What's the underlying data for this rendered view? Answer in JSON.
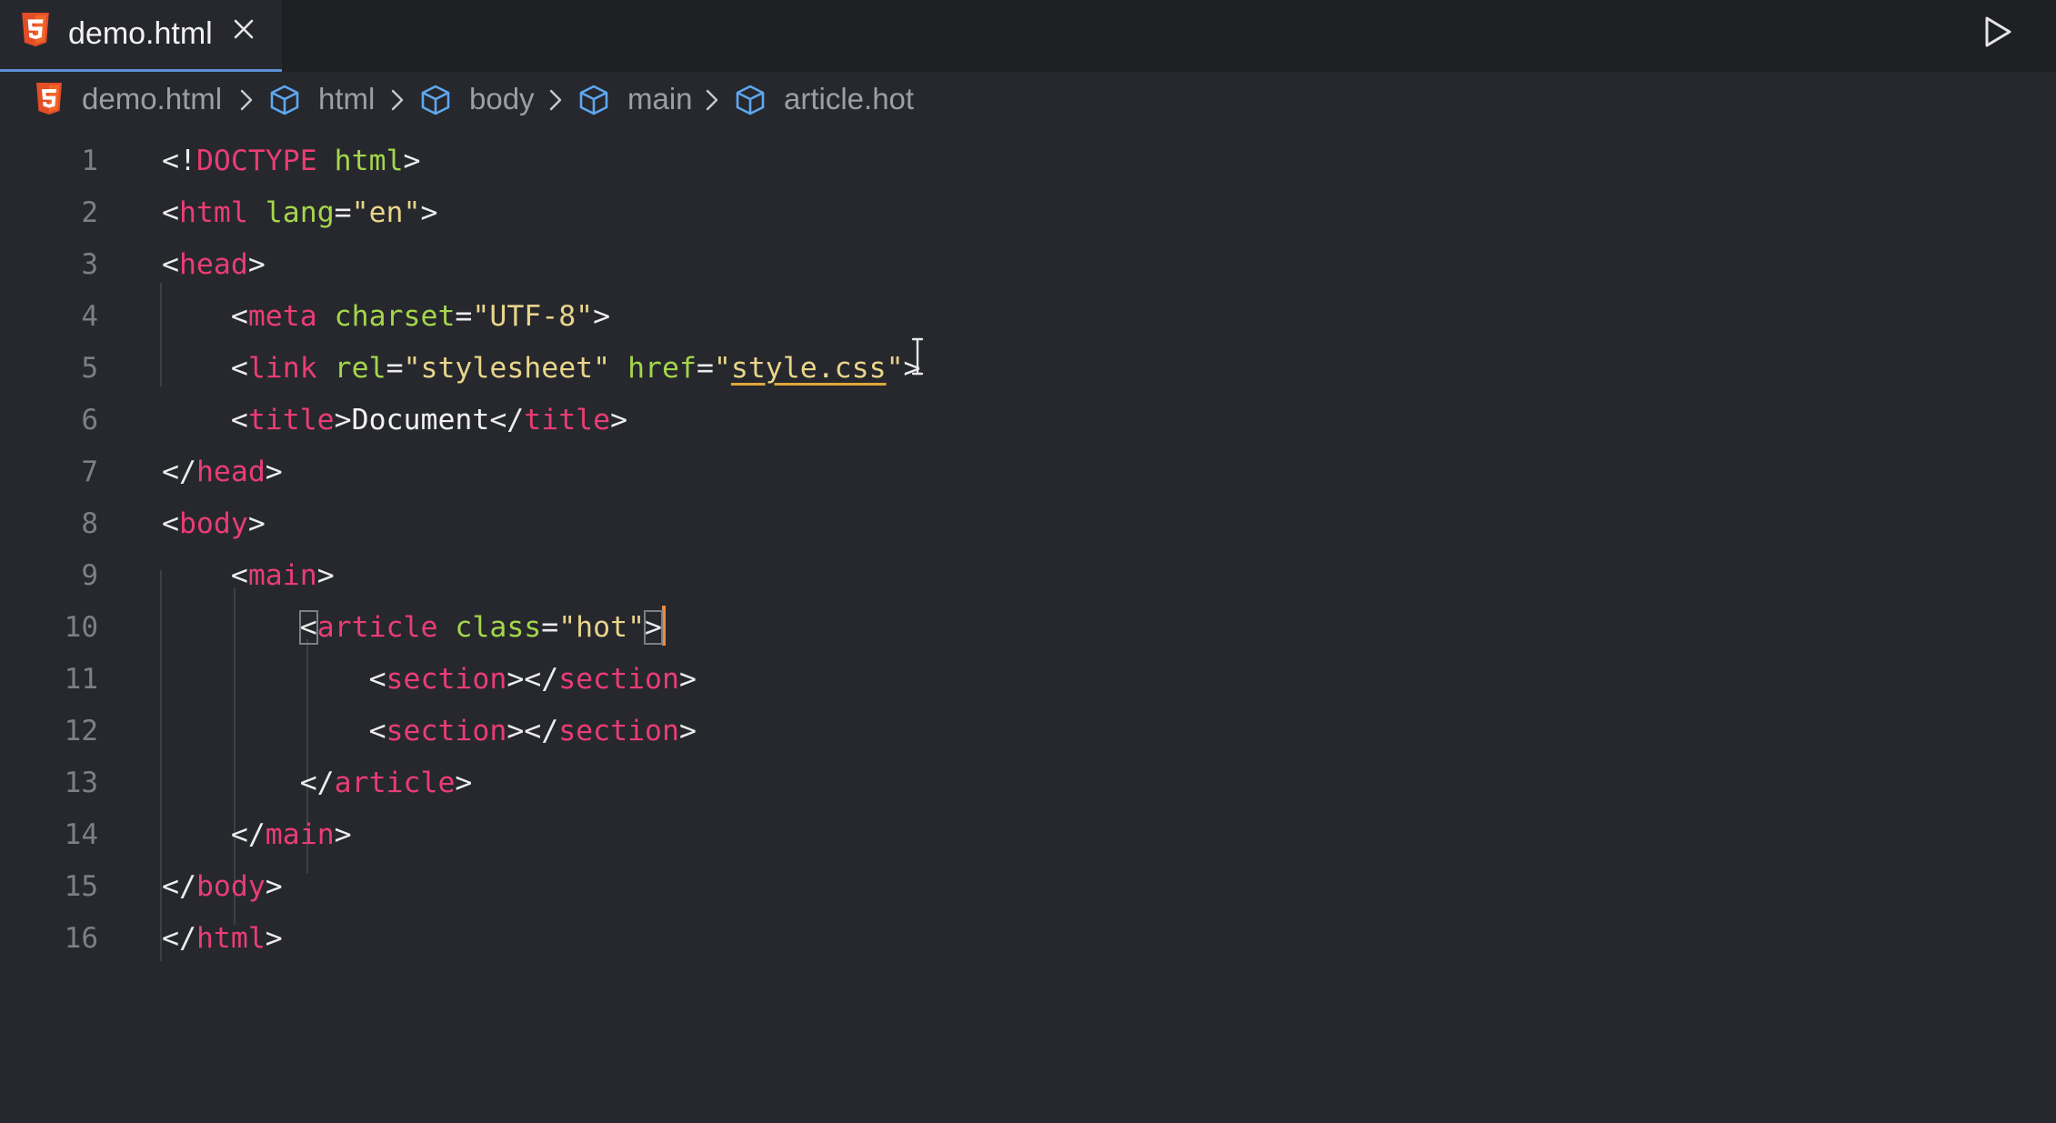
{
  "tab": {
    "title": "demo.html",
    "icon": "html5-icon",
    "close_icon": "close-icon"
  },
  "toolbar": {
    "run_icon": "play-icon"
  },
  "breadcrumb": {
    "file": "demo.html",
    "path": [
      "html",
      "body",
      "main",
      "article.hot"
    ]
  },
  "colors": {
    "background": "#26282d",
    "tabbar": "#1e2023",
    "tag": "#ea3d73",
    "attribute": "#a5d64b",
    "string": "#e9d58a",
    "line_number": "#7b8088",
    "caret": "#ef8a3a",
    "html_icon": "#e44d26",
    "cube_icon": "#5fa8f0"
  },
  "editor": {
    "line_numbers": [
      "1",
      "2",
      "3",
      "4",
      "5",
      "6",
      "7",
      "8",
      "9",
      "10",
      "11",
      "12",
      "13",
      "14",
      "15",
      "16"
    ],
    "lines": [
      [
        [
          "punc",
          "<!"
        ],
        [
          "tag",
          "DOCTYPE"
        ],
        [
          "punc",
          " "
        ],
        [
          "attr",
          "html"
        ],
        [
          "punc",
          ">"
        ]
      ],
      [
        [
          "punc",
          "<"
        ],
        [
          "tag",
          "html"
        ],
        [
          "punc",
          " "
        ],
        [
          "attr",
          "lang"
        ],
        [
          "punc",
          "="
        ],
        [
          "str",
          "\"en\""
        ],
        [
          "punc",
          ">"
        ]
      ],
      [
        [
          "punc",
          "<"
        ],
        [
          "tag",
          "head"
        ],
        [
          "punc",
          ">"
        ]
      ],
      [
        [
          "punc",
          "    <"
        ],
        [
          "tag",
          "meta"
        ],
        [
          "punc",
          " "
        ],
        [
          "attr",
          "charset"
        ],
        [
          "punc",
          "="
        ],
        [
          "str",
          "\"UTF-8\""
        ],
        [
          "punc",
          ">"
        ]
      ],
      [
        [
          "punc",
          "    <"
        ],
        [
          "tag",
          "link"
        ],
        [
          "punc",
          " "
        ],
        [
          "attr",
          "rel"
        ],
        [
          "punc",
          "="
        ],
        [
          "str",
          "\"stylesheet\""
        ],
        [
          "punc",
          " "
        ],
        [
          "attr",
          "href"
        ],
        [
          "punc",
          "="
        ],
        [
          "str",
          "\""
        ],
        [
          "link",
          "style.css"
        ],
        [
          "str",
          "\""
        ],
        [
          "punc",
          ">"
        ]
      ],
      [
        [
          "punc",
          "    <"
        ],
        [
          "tag",
          "title"
        ],
        [
          "punc",
          ">"
        ],
        [
          "text",
          "Document"
        ],
        [
          "punc",
          "</"
        ],
        [
          "tag",
          "title"
        ],
        [
          "punc",
          ">"
        ]
      ],
      [
        [
          "punc",
          "</"
        ],
        [
          "tag",
          "head"
        ],
        [
          "punc",
          ">"
        ]
      ],
      [
        [
          "punc",
          "<"
        ],
        [
          "tag",
          "body"
        ],
        [
          "punc",
          ">"
        ]
      ],
      [
        [
          "punc",
          "    <"
        ],
        [
          "tag",
          "main"
        ],
        [
          "punc",
          ">"
        ]
      ],
      [
        [
          "punc",
          "        "
        ],
        [
          "hl",
          "<"
        ],
        [
          "tag",
          "article"
        ],
        [
          "punc",
          " "
        ],
        [
          "attr",
          "class"
        ],
        [
          "punc",
          "="
        ],
        [
          "str",
          "\"hot\""
        ],
        [
          "hl",
          ">"
        ],
        [
          "caret",
          ""
        ]
      ],
      [
        [
          "punc",
          "            <"
        ],
        [
          "tag",
          "section"
        ],
        [
          "punc",
          "></"
        ],
        [
          "tag",
          "section"
        ],
        [
          "punc",
          ">"
        ]
      ],
      [
        [
          "punc",
          "            <"
        ],
        [
          "tag",
          "section"
        ],
        [
          "punc",
          "></"
        ],
        [
          "tag",
          "section"
        ],
        [
          "punc",
          ">"
        ]
      ],
      [
        [
          "punc",
          "        </"
        ],
        [
          "tag",
          "article"
        ],
        [
          "punc",
          ">"
        ]
      ],
      [
        [
          "punc",
          "    </"
        ],
        [
          "tag",
          "main"
        ],
        [
          "punc",
          ">"
        ]
      ],
      [
        [
          "punc",
          "</"
        ],
        [
          "tag",
          "body"
        ],
        [
          "punc",
          ">"
        ]
      ],
      [
        [
          "punc",
          "</"
        ],
        [
          "tag",
          "html"
        ],
        [
          "punc",
          ">"
        ]
      ]
    ]
  }
}
